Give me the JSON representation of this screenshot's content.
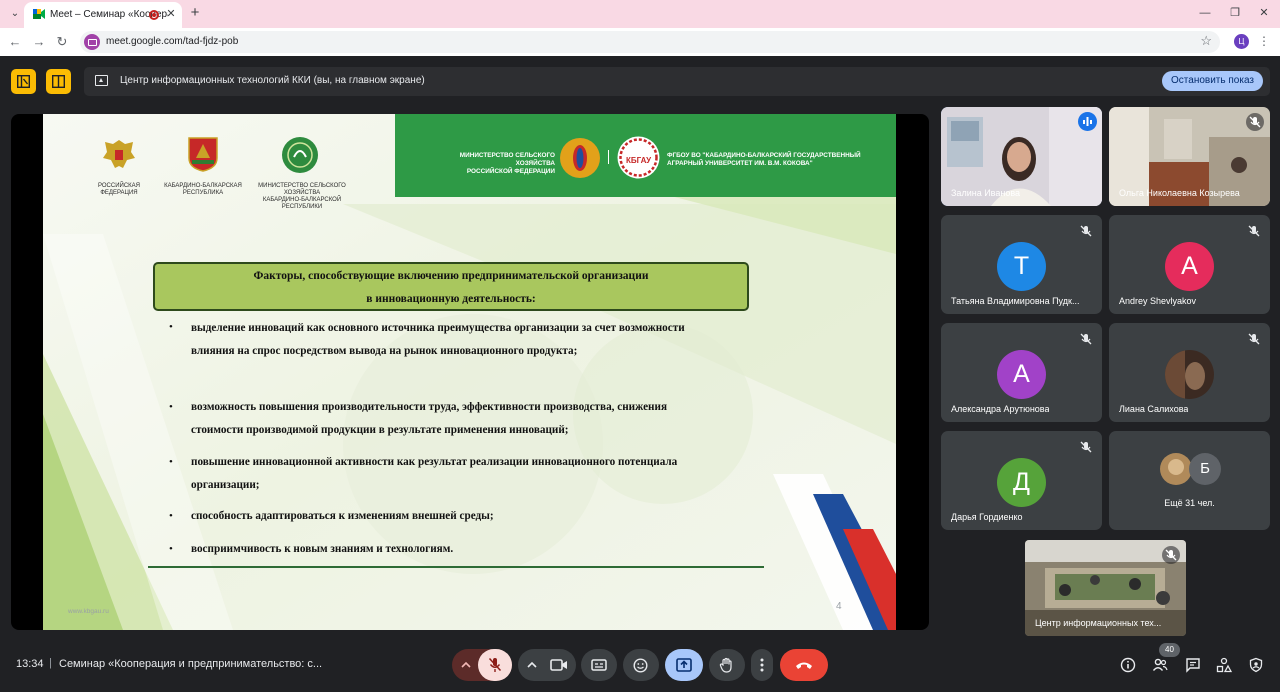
{
  "browser": {
    "tab_title": "Meet – Семинар «Коопера",
    "url": "meet.google.com/tad-fjdz-pob",
    "profile_letter": "Ц"
  },
  "presenting": {
    "text": "Центр информационных технологий ККИ (вы, на главном экране)",
    "stop_label": "Остановить показ"
  },
  "slide": {
    "emblems": [
      {
        "label": "РОССИЙСКАЯ ФЕДЕРАЦИЯ"
      },
      {
        "label": "КАБАРДИНО-БАЛКАРСКАЯ\nРЕСПУБЛИКА"
      },
      {
        "label": "МИНИСТЕРСТВО СЕЛЬСКОГО ХОЗЯЙСТВА\nКАБАРДИНО-БАЛКАРСКОЙ РЕСПУБЛИКИ"
      }
    ],
    "ministry_rf": "МИНИСТЕРСТВО СЕЛЬСКОГО ХОЗЯЙСТВА\nРОССИЙСКОЙ ФЕДЕРАЦИИ",
    "university": "ФГБОУ ВО \"КАБАРДИНО-БАЛКАРСКИЙ ГОСУДАРСТВЕННЫЙ\nАГРАРНЫЙ УНИВЕРСИТЕТ ИМ. В.М. КОКОВА\"",
    "university_logo_text": "КБГАУ",
    "title_line1": "Факторы, способствующие включению предпринимательской организации",
    "title_line2": "в инновационную деятельность:",
    "bullets": [
      "выделение инноваций как основного источника преимущества организации за счет возможности влияния на спрос посредством вывода на рынок инновационного продукта;",
      "возможность повышения производительности труда, эффективности производства, снижения стоимости производимой продукции в результате применения инноваций;",
      "повышение инновационной активности как результат реализации инновационного потенциала организации;",
      "способность адаптироваться к изменениям внешней среды;",
      "восприимчивость к новым знаниям и технологиям."
    ],
    "website": "www.kbgau.ru",
    "page_number": "4"
  },
  "participants": [
    {
      "name": "Залина Иванова",
      "type": "video",
      "speaking": true
    },
    {
      "name": "Ольга Николаевна Козырева",
      "type": "video",
      "muted": true
    },
    {
      "name": "Татьяна Владимировна Пудк...",
      "initial": "Т",
      "color": "#1e88e5",
      "muted": true
    },
    {
      "name": "Andrey Shevlyakov",
      "initial": "А",
      "color": "#e52c5c",
      "muted": true
    },
    {
      "name": "Александра Арутюнова",
      "initial": "А",
      "color": "#a142c8",
      "muted": true
    },
    {
      "name": "Лиана Салихова",
      "type": "photo",
      "muted": true
    },
    {
      "name": "Дарья Гордиенко",
      "initial": "Д",
      "color": "#56a33a",
      "muted": true
    },
    {
      "name": "Ещё 31 чел.",
      "initial": "Б"
    }
  ],
  "self_view": {
    "name": "Центр информационных тех..."
  },
  "bottom": {
    "time": "13:34",
    "separator": "|",
    "meeting_title": "Семинар «Кооперация и предпринимательство: с...",
    "people_count": "40"
  },
  "colors": {
    "accent": "#a8c7fa",
    "end_call": "#ea4335",
    "slide_green": "#2e9a46",
    "title_box": "#a9c75e"
  }
}
